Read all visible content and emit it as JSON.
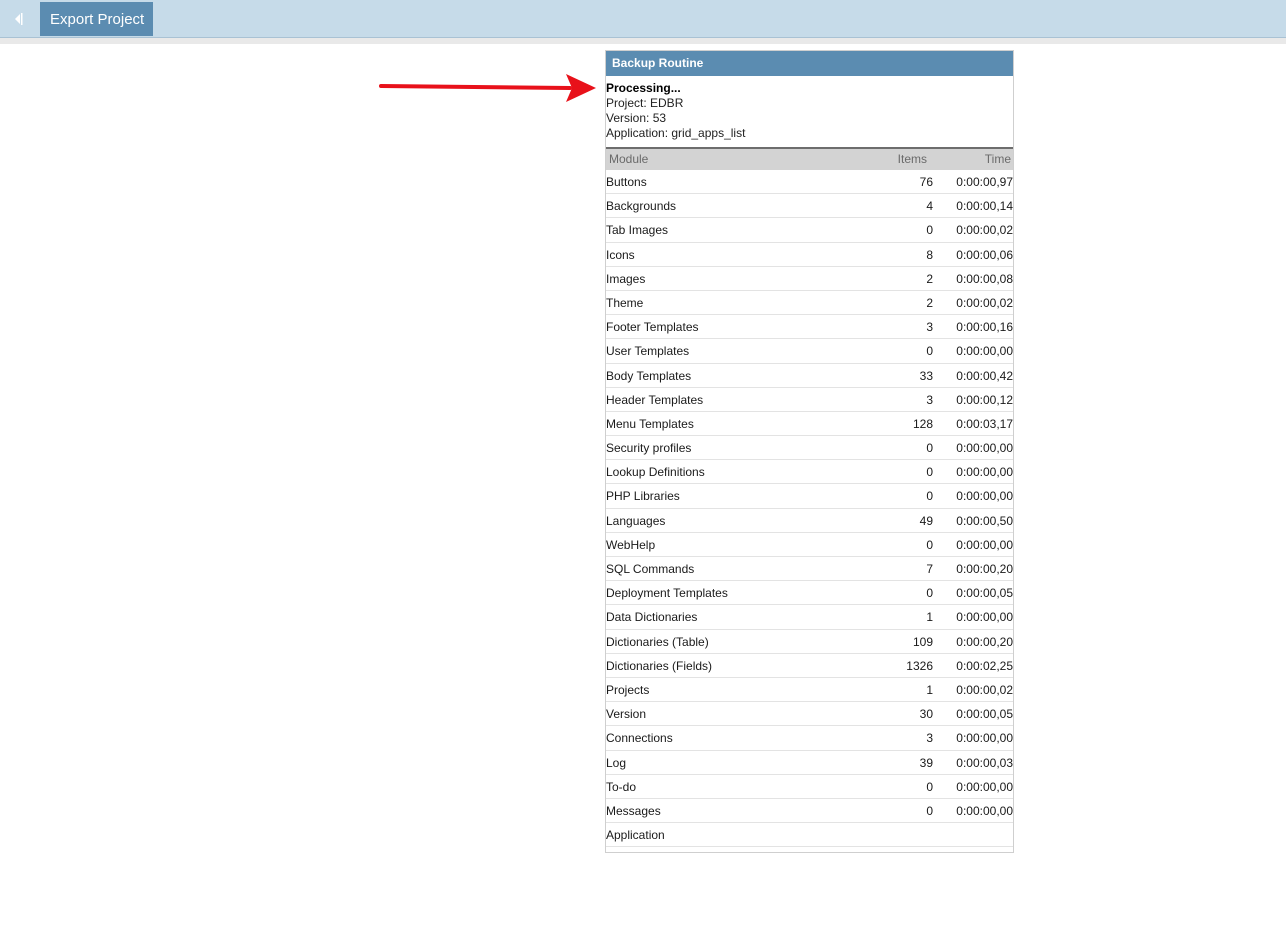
{
  "toolbar": {
    "back_icon": "triangle-left-icon",
    "tab_label": "Export Project"
  },
  "colors": {
    "topbar": "#c6dbe9",
    "accent": "#5b8cb1",
    "arrow": "#e8111a"
  },
  "panel": {
    "title": "Backup Routine",
    "status": "Processing...",
    "project": "Project: EDBR",
    "version": "Version: 53",
    "application": "Application: grid_apps_list",
    "columns": [
      "Module",
      "Items",
      "Time"
    ],
    "rows": [
      {
        "module": "Buttons",
        "items": "76",
        "time": "0:00:00,97"
      },
      {
        "module": "Backgrounds",
        "items": "4",
        "time": "0:00:00,14"
      },
      {
        "module": "Tab Images",
        "items": "0",
        "time": "0:00:00,02"
      },
      {
        "module": "Icons",
        "items": "8",
        "time": "0:00:00,06"
      },
      {
        "module": "Images",
        "items": "2",
        "time": "0:00:00,08"
      },
      {
        "module": "Theme",
        "items": "2",
        "time": "0:00:00,02"
      },
      {
        "module": "Footer Templates",
        "items": "3",
        "time": "0:00:00,16"
      },
      {
        "module": "User Templates",
        "items": "0",
        "time": "0:00:00,00"
      },
      {
        "module": "Body Templates",
        "items": "33",
        "time": "0:00:00,42"
      },
      {
        "module": "Header Templates",
        "items": "3",
        "time": "0:00:00,12"
      },
      {
        "module": "Menu Templates",
        "items": "128",
        "time": "0:00:03,17"
      },
      {
        "module": "Security profiles",
        "items": "0",
        "time": "0:00:00,00"
      },
      {
        "module": "Lookup Definitions",
        "items": "0",
        "time": "0:00:00,00"
      },
      {
        "module": "PHP Libraries",
        "items": "0",
        "time": "0:00:00,00"
      },
      {
        "module": "Languages",
        "items": "49",
        "time": "0:00:00,50"
      },
      {
        "module": "WebHelp",
        "items": "0",
        "time": "0:00:00,00"
      },
      {
        "module": "SQL Commands",
        "items": "7",
        "time": "0:00:00,20"
      },
      {
        "module": "Deployment Templates",
        "items": "0",
        "time": "0:00:00,05"
      },
      {
        "module": "Data Dictionaries",
        "items": "1",
        "time": "0:00:00,00"
      },
      {
        "module": "Dictionaries (Table)",
        "items": "109",
        "time": "0:00:00,20"
      },
      {
        "module": "Dictionaries (Fields)",
        "items": "1326",
        "time": "0:00:02,25"
      },
      {
        "module": "Projects",
        "items": "1",
        "time": "0:00:00,02"
      },
      {
        "module": "Version",
        "items": "30",
        "time": "0:00:00,05"
      },
      {
        "module": "Connections",
        "items": "3",
        "time": "0:00:00,00"
      },
      {
        "module": "Log",
        "items": "39",
        "time": "0:00:00,03"
      },
      {
        "module": "To-do",
        "items": "0",
        "time": "0:00:00,00"
      },
      {
        "module": "Messages",
        "items": "0",
        "time": "0:00:00,00"
      },
      {
        "module": "Application",
        "items": "",
        "time": ""
      }
    ]
  }
}
